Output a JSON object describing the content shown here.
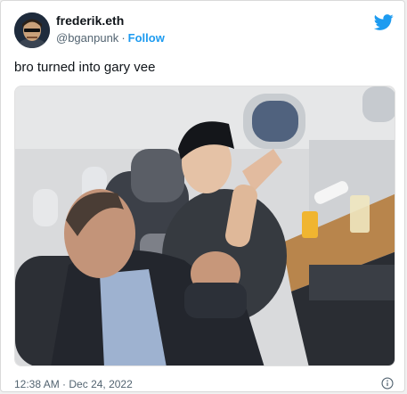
{
  "author": {
    "display_name": "frederik.eth",
    "handle": "@bganpunk",
    "separator": "·",
    "follow_label": "Follow"
  },
  "tweet": {
    "text": "bro turned into gary vee"
  },
  "meta": {
    "time": "12:38 AM",
    "separator": "·",
    "date": "Dec 24, 2022"
  },
  "icons": {
    "logo": "twitter-bird-icon",
    "info": "info-icon"
  },
  "colors": {
    "accent": "#1d9bf0",
    "text": "#0f1419",
    "secondary": "#536471"
  }
}
